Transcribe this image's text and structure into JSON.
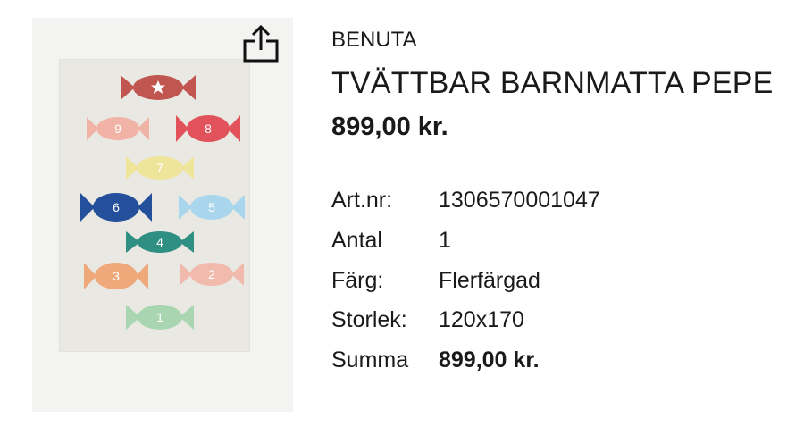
{
  "product": {
    "brand": "BENUTA",
    "title": "TVÄTTBAR BARNMATTA PEPE",
    "price": "899,00 kr."
  },
  "details": {
    "art_nr": {
      "label": "Art.nr:",
      "value": "1306570001047"
    },
    "antal": {
      "label": "Antal",
      "value": "1"
    },
    "farg": {
      "label": "Färg:",
      "value": "Flerfärgad"
    },
    "storlek": {
      "label": "Storlek:",
      "value": "120x170"
    },
    "summa": {
      "label": "Summa",
      "value": "899,00 kr."
    }
  },
  "rug_candies": [
    {
      "label": "",
      "color": "#c0564f",
      "has_star": true
    },
    {
      "label": "9",
      "color": "#f0b3a6"
    },
    {
      "label": "8",
      "color": "#e2525a"
    },
    {
      "label": "7",
      "color": "#efe59a"
    },
    {
      "label": "6",
      "color": "#244f9a"
    },
    {
      "label": "5",
      "color": "#a9d6ec"
    },
    {
      "label": "4",
      "color": "#2f8f82"
    },
    {
      "label": "3",
      "color": "#eea87a"
    },
    {
      "label": "2",
      "color": "#f2b9ad"
    },
    {
      "label": "1",
      "color": "#a9d6b0"
    }
  ],
  "icons": {
    "share": "share-icon"
  }
}
